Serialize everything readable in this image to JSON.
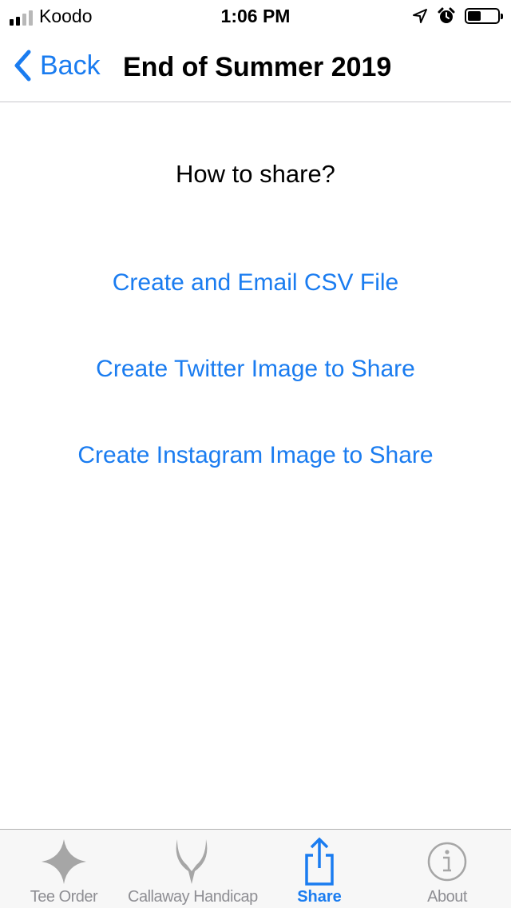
{
  "status_bar": {
    "carrier": "Koodo",
    "time": "1:06 PM",
    "signal_bars_filled": 2,
    "signal_bars_total": 4,
    "battery_level_percent": 45
  },
  "nav": {
    "back_label": "Back",
    "title": "End of Summer 2019"
  },
  "content": {
    "prompt": "How to share?",
    "actions": [
      "Create and Email CSV File",
      "Create Twitter Image to Share",
      "Create Instagram Image to Share"
    ]
  },
  "tab_bar": {
    "tabs": [
      {
        "label": "Tee Order",
        "icon": "star-icon",
        "active": false
      },
      {
        "label": "Callaway Handicap",
        "icon": "horns-icon",
        "active": false
      },
      {
        "label": "Share",
        "icon": "share-icon",
        "active": true
      },
      {
        "label": "About",
        "icon": "info-icon",
        "active": false
      }
    ]
  },
  "colors": {
    "accent": "#1a7cf0",
    "inactive": "#8e8e93",
    "icon_gray": "#a6a6a6",
    "tab_bar_bg": "#f7f7f7"
  }
}
